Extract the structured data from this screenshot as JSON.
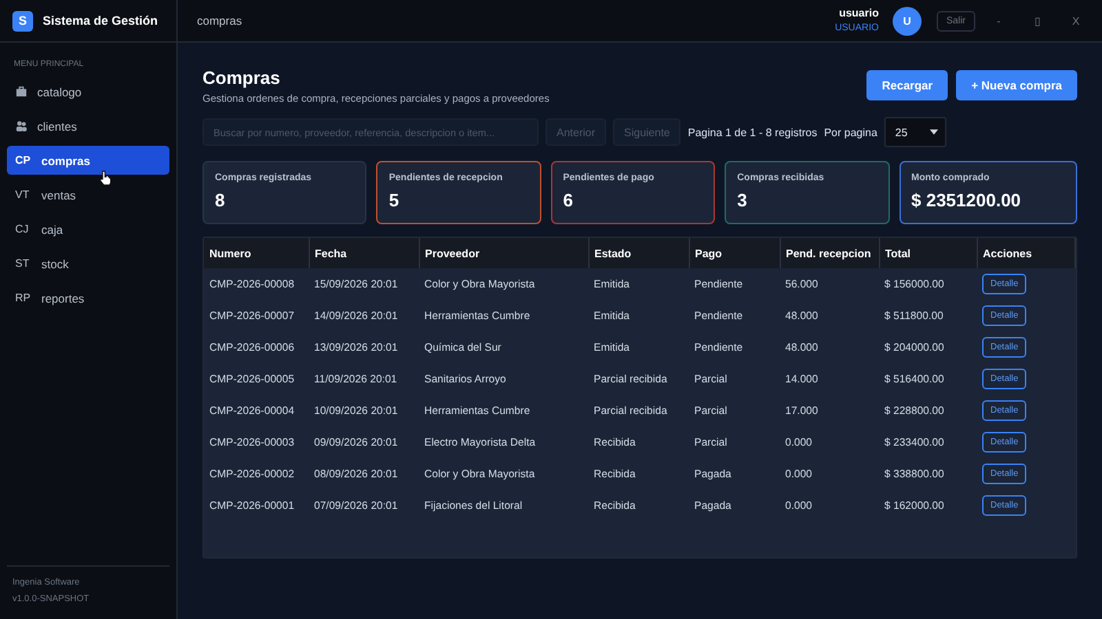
{
  "app": {
    "logo": "S",
    "title": "Sistema de Gestión"
  },
  "breadcrumb": "compras",
  "user": {
    "name": "usuario",
    "role": "USUARIO",
    "avatar": "U",
    "logout": "Salir"
  },
  "window_controls": [
    "-",
    "▯",
    "X"
  ],
  "sidebar": {
    "heading": "MENU PRINCIPAL",
    "items": [
      {
        "kind": "glyph",
        "label": "catalogo",
        "selected": false
      },
      {
        "kind": "glyph",
        "label": "clientes",
        "selected": false
      },
      {
        "kind": "code",
        "code": "CP",
        "label": "compras",
        "selected": true
      },
      {
        "kind": "code",
        "code": "VT",
        "label": "ventas",
        "selected": false
      },
      {
        "kind": "code",
        "code": "CJ",
        "label": "caja",
        "selected": false
      },
      {
        "kind": "code",
        "code": "ST",
        "label": "stock",
        "selected": false
      },
      {
        "kind": "code",
        "code": "RP",
        "label": "reportes",
        "selected": false
      }
    ],
    "footer": [
      "Ingenia Software",
      "v1.0.0-SNAPSHOT"
    ]
  },
  "page": {
    "title": "Compras",
    "subtitle": "Gestiona ordenes de compra, recepciones parciales y pagos a proveedores",
    "buttons": [
      "Recargar",
      "+ Nueva compra"
    ]
  },
  "search": {
    "placeholder": "Buscar por numero, proveedor, referencia, descripcion o item..."
  },
  "pager": {
    "prev": "Anterior",
    "next": "Siguiente",
    "info": "Pagina 1 de 1 - 8 registros",
    "per_page_label": "Por pagina",
    "per_page": "25"
  },
  "stats": [
    {
      "label": "Compras registradas",
      "value": "8",
      "color": "#2a3447"
    },
    {
      "label": "Pendientes de recepcion",
      "value": "5",
      "color": "#c0502e"
    },
    {
      "label": "Pendientes de pago",
      "value": "6",
      "color": "#a83838"
    },
    {
      "label": "Compras recibidas",
      "value": "3",
      "color": "#1f6b66"
    },
    {
      "label": "Monto comprado",
      "value": "$ 2351200.00",
      "color": "#3b6fd6"
    }
  ],
  "table": {
    "columns": [
      "Numero",
      "Fecha",
      "Proveedor",
      "Estado",
      "Pago",
      "Pend. recepcion",
      "Total",
      "Acciones"
    ],
    "rows": [
      {
        "cells": [
          "CMP-2026-00008",
          "15/09/2026 20:01",
          "Color y Obra Mayorista",
          "Emitida",
          "Pendiente",
          "56.000",
          "$ 156000.00"
        ],
        "action": "Detalle"
      },
      {
        "cells": [
          "CMP-2026-00007",
          "14/09/2026 20:01",
          "Herramientas Cumbre",
          "Emitida",
          "Pendiente",
          "48.000",
          "$ 511800.00"
        ],
        "action": "Detalle"
      },
      {
        "cells": [
          "CMP-2026-00006",
          "13/09/2026 20:01",
          "Química del Sur",
          "Emitida",
          "Pendiente",
          "48.000",
          "$ 204000.00"
        ],
        "action": "Detalle"
      },
      {
        "cells": [
          "CMP-2026-00005",
          "11/09/2026 20:01",
          "Sanitarios Arroyo",
          "Parcial recibida",
          "Parcial",
          "14.000",
          "$ 516400.00"
        ],
        "action": "Detalle"
      },
      {
        "cells": [
          "CMP-2026-00004",
          "10/09/2026 20:01",
          "Herramientas Cumbre",
          "Parcial recibida",
          "Parcial",
          "17.000",
          "$ 228800.00"
        ],
        "action": "Detalle"
      },
      {
        "cells": [
          "CMP-2026-00003",
          "09/09/2026 20:01",
          "Electro Mayorista Delta",
          "Recibida",
          "Parcial",
          "0.000",
          "$ 233400.00"
        ],
        "action": "Detalle"
      },
      {
        "cells": [
          "CMP-2026-00002",
          "08/09/2026 20:01",
          "Color y Obra Mayorista",
          "Recibida",
          "Pagada",
          "0.000",
          "$ 338800.00"
        ],
        "action": "Detalle"
      },
      {
        "cells": [
          "CMP-2026-00001",
          "07/09/2026 20:01",
          "Fijaciones del Litoral",
          "Recibida",
          "Pagada",
          "0.000",
          "$ 162000.00"
        ],
        "action": "Detalle"
      }
    ]
  }
}
